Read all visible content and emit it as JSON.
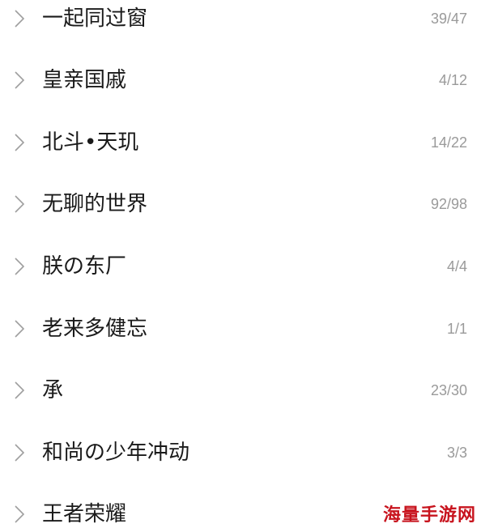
{
  "list": {
    "items": [
      {
        "name": "一起同过窗",
        "count": "39/47"
      },
      {
        "name": "皇亲国戚",
        "count": "4/12"
      },
      {
        "name": "北斗•天玑",
        "count": "14/22"
      },
      {
        "name": "无聊的世界",
        "count": "92/98"
      },
      {
        "name": "朕の东厂",
        "count": "4/4"
      },
      {
        "name": "老来多健忘",
        "count": "1/1"
      },
      {
        "name": "承",
        "count": "23/30"
      },
      {
        "name": "和尚の少年冲动",
        "count": "3/3"
      },
      {
        "name": "王者荣耀",
        "count": ""
      }
    ]
  },
  "watermark": {
    "text": "海量手游网"
  },
  "colors": {
    "name_text": "#1a1a1a",
    "count_text": "#9a9a9a",
    "chevron": "#9e9e9e",
    "watermark": "#c8141e"
  },
  "icons": {
    "row_chevron": "chevron-right-icon"
  }
}
